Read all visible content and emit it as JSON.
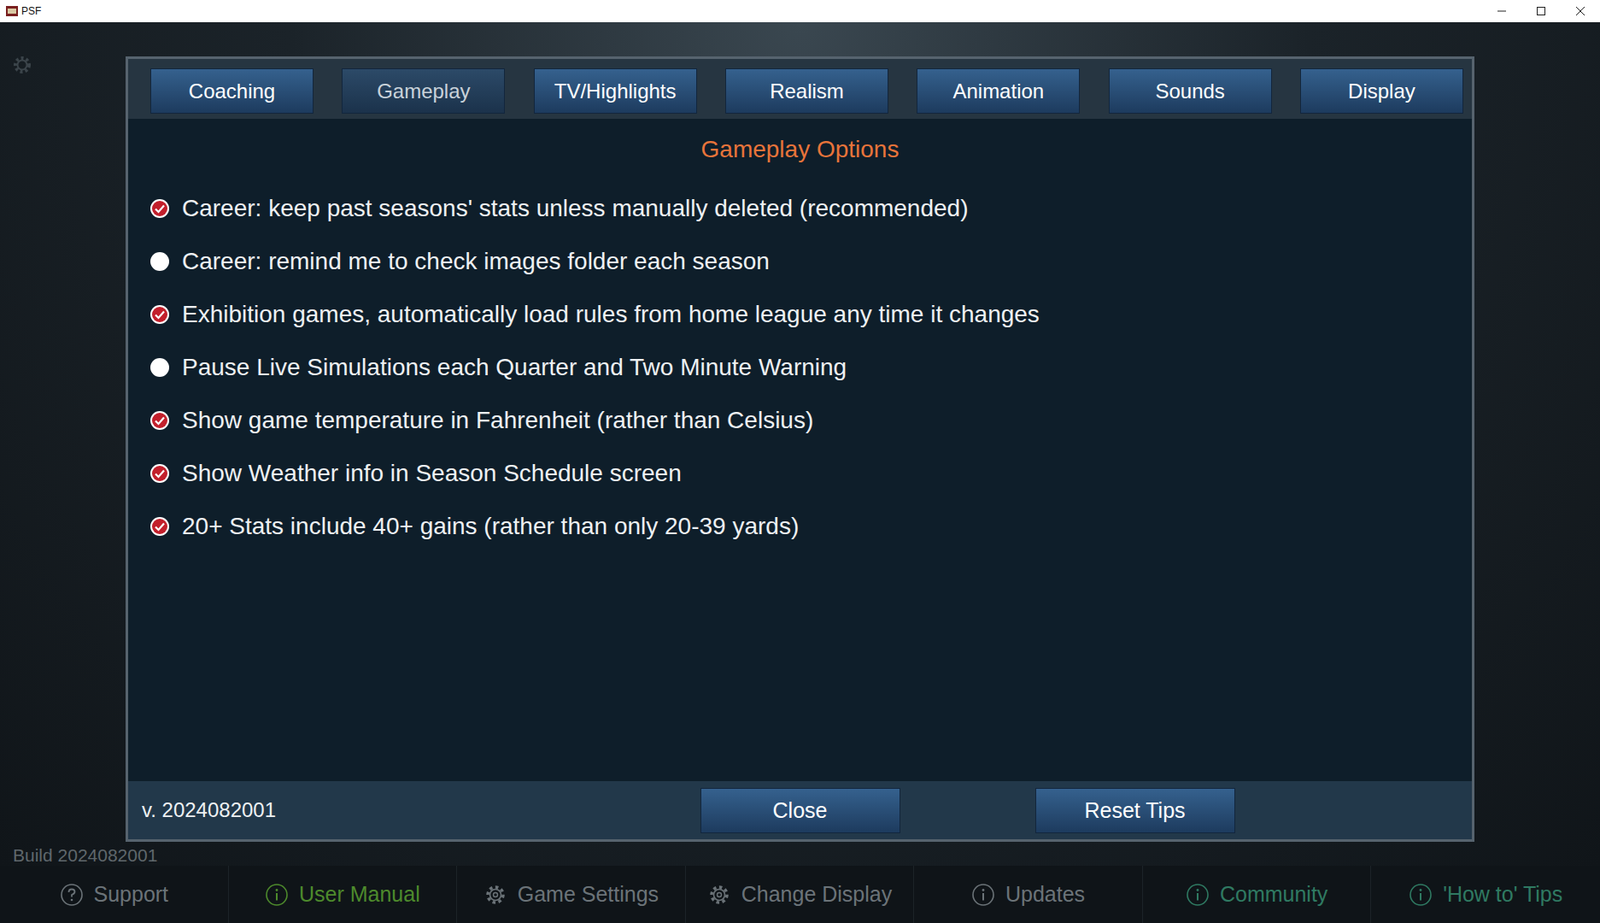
{
  "window": {
    "title": "PSF"
  },
  "tabs": [
    {
      "label": "Coaching",
      "selected": false
    },
    {
      "label": "Gameplay",
      "selected": true
    },
    {
      "label": "TV/Highlights",
      "selected": false
    },
    {
      "label": "Realism",
      "selected": false
    },
    {
      "label": "Animation",
      "selected": false
    },
    {
      "label": "Sounds",
      "selected": false
    },
    {
      "label": "Display",
      "selected": false
    }
  ],
  "dialog": {
    "heading": "Gameplay Options",
    "options": [
      {
        "label": "Career: keep past seasons' stats unless manually deleted (recommended)",
        "checked": true
      },
      {
        "label": "Career: remind me to check images folder each season",
        "checked": false
      },
      {
        "label": "Exhibition games, automatically load rules from home league any time it changes",
        "checked": true
      },
      {
        "label": "Pause Live Simulations each Quarter and Two Minute Warning",
        "checked": false
      },
      {
        "label": "Show game temperature in Fahrenheit (rather than Celsius)",
        "checked": true
      },
      {
        "label": "Show Weather info in Season Schedule screen",
        "checked": true
      },
      {
        "label": "20+ Stats include 40+ gains (rather than only 20-39 yards)",
        "checked": true
      }
    ],
    "version": "v. 2024082001",
    "buttons": [
      "Close",
      "Reset Tips"
    ]
  },
  "build": "Build 2024082001",
  "bottom_bar": [
    {
      "label": "Support",
      "kind": "help",
      "color": "#6b7378"
    },
    {
      "label": "User Manual",
      "kind": "info",
      "color": "#4d8a2c"
    },
    {
      "label": "Game Settings",
      "kind": "gear",
      "color": "#6b7378"
    },
    {
      "label": "Change Display",
      "kind": "gear",
      "color": "#6b7378"
    },
    {
      "label": "Updates",
      "kind": "info",
      "color": "#6b7378"
    },
    {
      "label": "Community",
      "kind": "info",
      "color": "#2f7a62"
    },
    {
      "label": "'How to' Tips",
      "kind": "info",
      "color": "#2f7a62"
    }
  ]
}
